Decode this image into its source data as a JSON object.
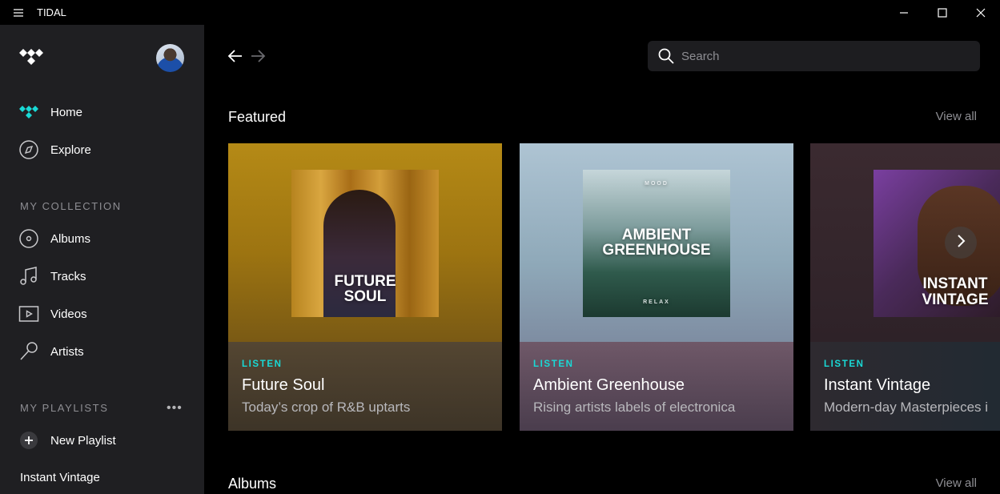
{
  "window": {
    "title": "TIDAL"
  },
  "sidebar": {
    "nav": [
      {
        "label": "Home",
        "icon": "tidal-icon"
      },
      {
        "label": "Explore",
        "icon": "compass-icon"
      }
    ],
    "collection_heading": "MY COLLECTION",
    "collection": [
      {
        "label": "Albums",
        "icon": "album-icon"
      },
      {
        "label": "Tracks",
        "icon": "music-note-icon"
      },
      {
        "label": "Videos",
        "icon": "video-icon"
      },
      {
        "label": "Artists",
        "icon": "microphone-icon"
      }
    ],
    "playlists_heading": "MY PLAYLISTS",
    "more_label": "•••",
    "new_playlist_label": "New Playlist",
    "playlists": [
      "Instant Vintage"
    ]
  },
  "main": {
    "search_placeholder": "Search",
    "featured": {
      "title": "Featured",
      "view_all": "View all",
      "cards": [
        {
          "tag": "LISTEN",
          "name": "Future Soul",
          "desc": "Today’s crop of R&B uptarts",
          "cover_line1": "FUTURE",
          "cover_line2": "SOUL"
        },
        {
          "tag": "LISTEN",
          "name": "Ambient Greenhouse",
          "desc": "Rising artists labels of electronica",
          "cover_top": "MOOD",
          "cover_line1": "AMBIENT",
          "cover_line2": "GREENHOUSE",
          "cover_bottom": "RELAX"
        },
        {
          "tag": "LISTEN",
          "name": "Instant Vintage",
          "desc": "Modern-day Masterpieces i",
          "cover_line1": "INSTANT",
          "cover_line2": "VINTAGE"
        }
      ]
    },
    "albums": {
      "title": "Albums",
      "view_all": "View all"
    }
  },
  "colors": {
    "accent": "#19d9d5",
    "sidebar_bg": "#1f1f22",
    "main_bg": "#000000"
  }
}
